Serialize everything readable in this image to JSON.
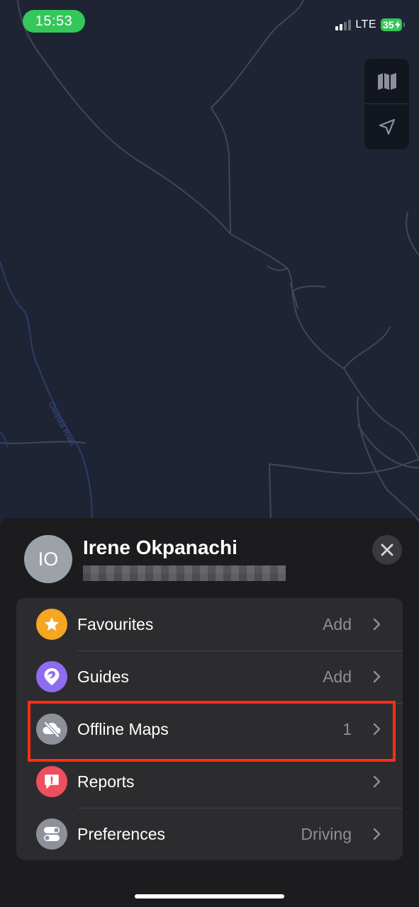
{
  "status_bar": {
    "time": "15:53",
    "network": "LTE",
    "battery": "35"
  },
  "map": {
    "river_label": "Gwaska River",
    "map_mode_icon": "map-icon",
    "locate_icon": "location-arrow-icon"
  },
  "profile": {
    "initials": "IO",
    "name": "Irene Okpanachi"
  },
  "menu": {
    "items": [
      {
        "label": "Favourites",
        "value": "Add",
        "icon": "star-icon",
        "color": "#f5a623"
      },
      {
        "label": "Guides",
        "value": "Add",
        "icon": "guide-pin-icon",
        "color": "#8e6cf0"
      },
      {
        "label": "Offline Maps",
        "value": "1",
        "icon": "cloud-off-icon",
        "color": "#8e9199"
      },
      {
        "label": "Reports",
        "value": "",
        "icon": "report-icon",
        "color": "#ef4e5e"
      },
      {
        "label": "Preferences",
        "value": "Driving",
        "icon": "toggles-icon",
        "color": "#8e9199"
      }
    ]
  },
  "colors": {
    "map_bg": "#1e2433",
    "sheet_bg": "#1c1c1e",
    "card_bg": "#2c2c2e",
    "highlight": "#ff2d14",
    "accent_green": "#34c759"
  }
}
